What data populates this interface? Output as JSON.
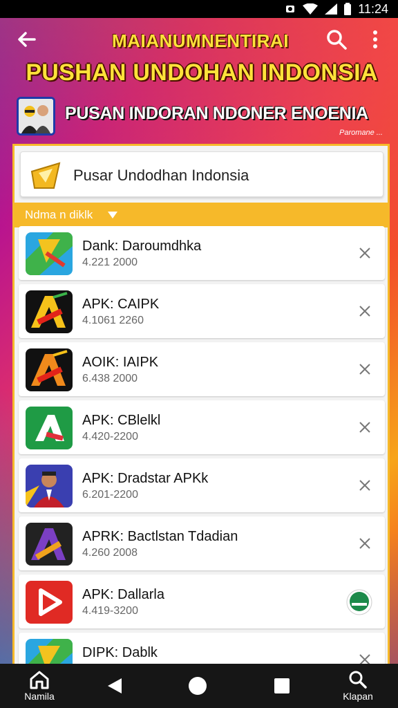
{
  "status_bar": {
    "time": "11:24"
  },
  "app_bar": {
    "title_small": "MAIANUMNENTIRAI",
    "title_big": "PUSHAN UNDOHAN INDONSIA",
    "subtitle": "PUSAN INDORAN NDONER ENOENIA",
    "credit": "Paromane ..."
  },
  "search": {
    "value": "Pusar Undodhan Indonsia"
  },
  "filter": {
    "label": "Ndma n diklk"
  },
  "apps": [
    {
      "name": "Dank: Daroumdhka",
      "meta": "4.221 2000",
      "icon": "maps-green-icon",
      "action": "close-icon"
    },
    {
      "name": "APK: CAIPK",
      "meta": "4.1061 2260",
      "icon": "apk-a-icon",
      "action": "close-icon"
    },
    {
      "name": "AOIK: IAIPK",
      "meta": "6.438 2000",
      "icon": "apk-a-icon",
      "action": "close-icon"
    },
    {
      "name": "APK: CBlelkl",
      "meta": "4.420-2200",
      "icon": "green-a-icon",
      "action": "close-icon"
    },
    {
      "name": "APK: Dradstar APKk",
      "meta": "6.201-2200",
      "icon": "person-icon",
      "action": "close-icon"
    },
    {
      "name": "APRK: Bactlstan Tdadian",
      "meta": "4.260 2008",
      "icon": "apk-purple-a-icon",
      "action": "close-icon"
    },
    {
      "name": "APK: Dallarla",
      "meta": "4.419-3200",
      "icon": "red-play-icon",
      "action": "install-badge-icon"
    },
    {
      "name": "DIPK: Dablk",
      "meta": "",
      "icon": "maps-green-icon",
      "action": "close-icon"
    }
  ],
  "nav": {
    "home_label": "Namila",
    "search_label": "Klapan"
  },
  "colors": {
    "accent": "#f6b92a",
    "title_yellow": "#ffe23a"
  }
}
